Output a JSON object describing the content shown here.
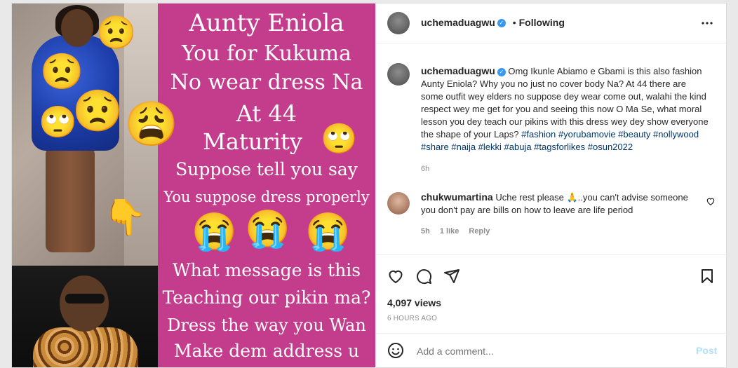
{
  "media": {
    "panel_lines": [
      "Aunty Eniola",
      "You for Kukuma",
      "No wear dress Na",
      "At 44",
      "Maturity",
      "Suppose tell you say",
      "You suppose dress properly",
      "What message is this",
      "Teaching our pikin ma?",
      "Dress the way you Wan",
      "Make dem address u"
    ],
    "emojis": {
      "frown": "😟",
      "eyeroll": "🙄",
      "weary": "😩",
      "point": "👇",
      "sob": "😭"
    }
  },
  "header": {
    "username": "uchemaduagwu",
    "verified_mark": "✓",
    "separator": "•",
    "follow_status": "Following",
    "more_icon": "more-horizontal-icon"
  },
  "caption": {
    "username": "uchemaduagwu",
    "text": "Omg Ikunle Abiamo e Gbami is this also fashion Aunty Eniola? Why you no just no cover body Na? At 44 there are some outfit wey elders no suppose dey wear come out, walahi the kind respect wey me get for you and seeing this now O Ma Se, what moral lesson you dey teach our pikins with this dress wey dey show everyone the shape of your Laps?",
    "hashtags": "#fashion #yorubamovie #beauty #nollywood #share #naija #lekki #abuja #tagsforlikes #osun2022",
    "time": "6h"
  },
  "comment": {
    "username": "chukwumartina",
    "text": "Uche rest please 🙏..you can't advise someone you don't pay are bills on how to leave are life period",
    "time": "5h",
    "likes": "1 like",
    "reply": "Reply"
  },
  "stats": {
    "views": "4,097 views",
    "age": "6 HOURS AGO"
  },
  "composer": {
    "placeholder": "Add a comment...",
    "post_label": "Post"
  },
  "colors": {
    "panel_bg": "#c43c8c",
    "link": "#00376b",
    "verified": "#3897f0",
    "post_disabled": "#b2dffc"
  }
}
